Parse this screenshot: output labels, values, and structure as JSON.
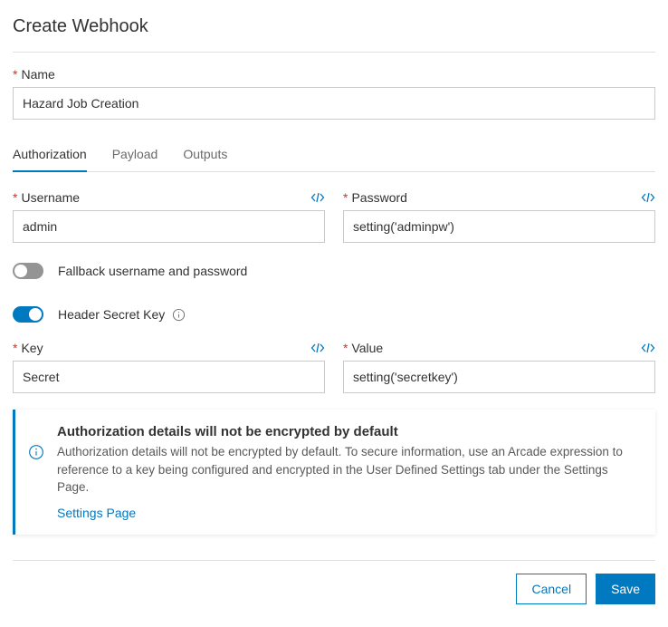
{
  "page_title": "Create Webhook",
  "name": {
    "label": "Name",
    "value": "Hazard Job Creation"
  },
  "tabs": [
    {
      "label": "Authorization",
      "active": true
    },
    {
      "label": "Payload",
      "active": false
    },
    {
      "label": "Outputs",
      "active": false
    }
  ],
  "username": {
    "label": "Username",
    "value": "admin"
  },
  "password": {
    "label": "Password",
    "value": "setting('adminpw')"
  },
  "fallback_toggle": {
    "label": "Fallback username and password",
    "on": false
  },
  "header_secret_toggle": {
    "label": "Header Secret Key",
    "on": true
  },
  "key_field": {
    "label": "Key",
    "value": "Secret"
  },
  "value_field": {
    "label": "Value",
    "value": "setting('secretkey')"
  },
  "notice": {
    "title": "Authorization details will not be encrypted by default",
    "body": "Authorization details will not be encrypted by default. To secure information, use an Arcade expression to reference to a key being configured and encrypted in the User Defined Settings tab under the Settings Page.",
    "link": "Settings Page"
  },
  "buttons": {
    "cancel": "Cancel",
    "save": "Save"
  }
}
